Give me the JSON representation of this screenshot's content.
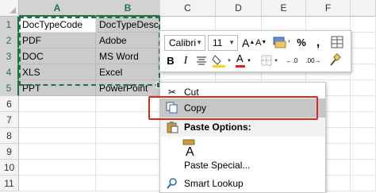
{
  "columns": [
    "A",
    "B",
    "C",
    "D",
    "E",
    "F"
  ],
  "rows": [
    "1",
    "2",
    "3",
    "4",
    "5",
    "6",
    "7",
    "8",
    "9",
    "10",
    "11"
  ],
  "cells": [
    [
      "DocTypeCode",
      "DocTypeDesc"
    ],
    [
      "PDF",
      "Adobe"
    ],
    [
      "DOC",
      "MS Word"
    ],
    [
      "XLS",
      "Excel"
    ],
    [
      "PPT",
      "PowerPoint"
    ]
  ],
  "mini_toolbar": {
    "font": "Calibri",
    "size": "11",
    "percent": "%",
    "comma": ",",
    "bold": "B",
    "italic": "I",
    "grow_font": "A",
    "shrink_font": "A",
    "font_color_letter": "A",
    "dec_inc": "←.0",
    "dec_dec": ".00→"
  },
  "context_menu": {
    "cut": "Cut",
    "copy": "Copy",
    "paste_options": "Paste Options:",
    "paste_icon_letter": "A",
    "paste_special": "Paste Special...",
    "smart_lookup": "Smart Lookup"
  },
  "colors": {
    "accent": "#217346",
    "highlight_box": "#d52b1e",
    "selection_fill": "#cbcbcb"
  }
}
